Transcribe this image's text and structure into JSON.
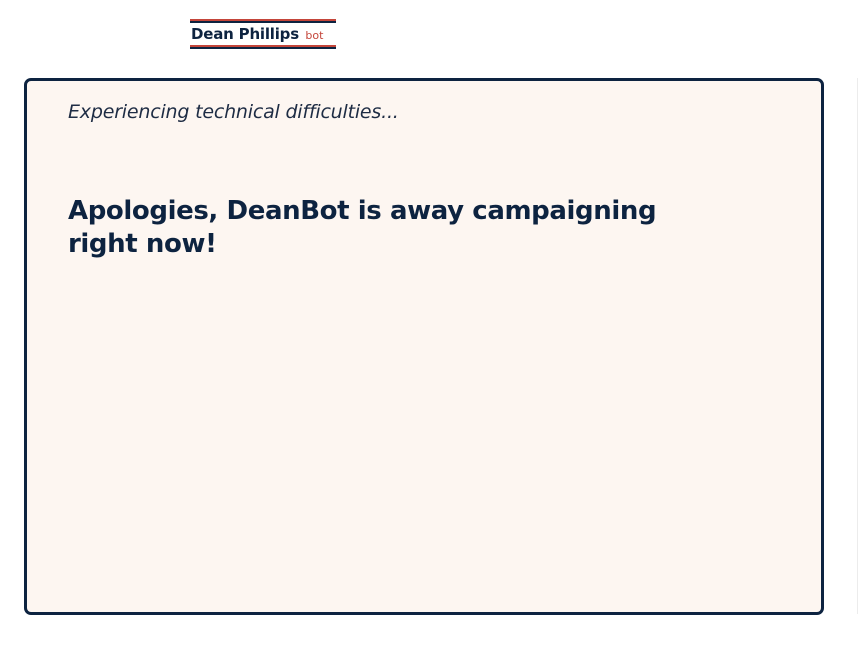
{
  "logo": {
    "name": "Dean Phillips",
    "suffix": "bot"
  },
  "colors": {
    "navy": "#0d2340",
    "red": "#c4453a",
    "card_background": "#fdf6f1"
  },
  "message": {
    "status": "Experiencing technical difficulties...",
    "headline": "Apologies, DeanBot is away campaigning right now!"
  }
}
